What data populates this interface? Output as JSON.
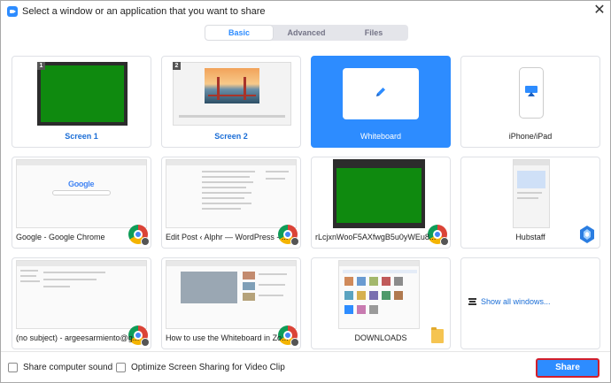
{
  "window": {
    "title": "Select a window or an application that you want to share",
    "close_glyph": "✕"
  },
  "tabs": [
    {
      "label": "Basic",
      "active": true
    },
    {
      "label": "Advanced",
      "active": false
    },
    {
      "label": "Files",
      "active": false
    }
  ],
  "tiles": [
    {
      "label": "Screen 1",
      "badge": "1",
      "kind": "screen",
      "icon": "green-screen"
    },
    {
      "label": "Screen 2",
      "badge": "2",
      "kind": "screen",
      "icon": "bridge-wallpaper"
    },
    {
      "label": "Whiteboard",
      "kind": "whiteboard",
      "icon": "pencil-icon",
      "selected": true
    },
    {
      "label": "iPhone/iPad",
      "kind": "device",
      "icon": "airplay-icon"
    },
    {
      "label": "Google - Google Chrome",
      "kind": "window",
      "app_icon": "chrome-icon",
      "google_logo": "Google"
    },
    {
      "label": "Edit Post ‹ Alphr — WordPress - ...",
      "kind": "window",
      "app_icon": "chrome-icon"
    },
    {
      "label": "rLcjxnWooF5AXfwgB5u0yWEu8...",
      "kind": "window",
      "app_icon": "chrome-icon"
    },
    {
      "label": "Hubstaff",
      "kind": "window",
      "app_icon": "hubstaff-icon"
    },
    {
      "label": "(no subject) - argeesarmiento@g...",
      "kind": "window",
      "app_icon": "chrome-icon"
    },
    {
      "label": "How to use the Whiteboard in Zo...",
      "kind": "window",
      "app_icon": "chrome-icon"
    },
    {
      "label": "DOWNLOADS",
      "kind": "window",
      "app_icon": "folder-icon"
    },
    {
      "label": "Show all windows...",
      "kind": "more",
      "icon": "stack-icon"
    }
  ],
  "footer": {
    "share_sound_label": "Share computer sound",
    "optimize_label": "Optimize Screen Sharing for Video Clip",
    "share_button": "Share"
  },
  "colors": {
    "accent": "#2d8cff",
    "highlight_border": "#d21f2c",
    "link": "#1a6dd6"
  }
}
